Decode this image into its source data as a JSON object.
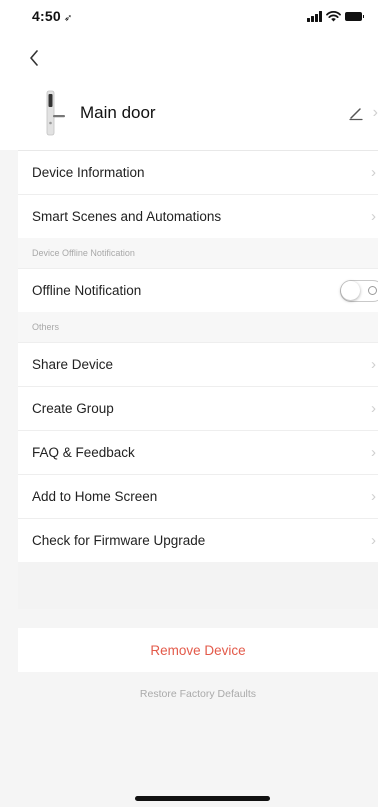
{
  "status_bar": {
    "time": "4:50",
    "location_glyph": "➶",
    "icons": [
      "signal-icon",
      "wifi-icon",
      "battery-icon"
    ]
  },
  "nav": {
    "back_glyph": "‹",
    "back_icon": "chevron-left-icon"
  },
  "device": {
    "name": "Main door",
    "icon": "door-lock-icon",
    "edit_icon": "pencil-icon"
  },
  "rows_top": [
    {
      "label": "Device Information"
    },
    {
      "label": "Smart Scenes and Automations"
    }
  ],
  "offline_section": {
    "header": "Device Offline Notification",
    "row_label": "Offline Notification",
    "enabled": false
  },
  "others_section": {
    "header": "Others",
    "rows": [
      {
        "label": "Share Device"
      },
      {
        "label": "Create Group"
      },
      {
        "label": "FAQ & Feedback"
      },
      {
        "label": "Add to Home Screen"
      },
      {
        "label": "Check for Firmware Upgrade"
      }
    ]
  },
  "actions": {
    "remove_label": "Remove Device",
    "restore_label": "Restore Factory Defaults"
  },
  "colors": {
    "danger": "#e35a4a",
    "muted_text": "#aaaaaa",
    "background": "#f5f5f5"
  }
}
